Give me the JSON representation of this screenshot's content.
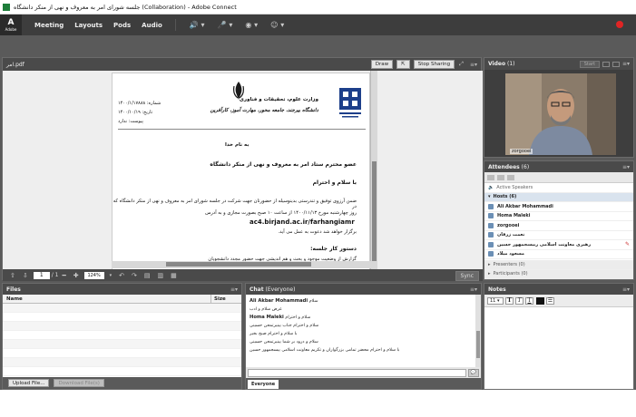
{
  "window": {
    "title": "جلسه شورای امر به معروف و نهی از منکر دانشگاه (Collaboration) - Adobe Connect"
  },
  "menubar": {
    "logo": "Adobe",
    "items": [
      "Meeting",
      "Layouts",
      "Pods",
      "Audio"
    ]
  },
  "share": {
    "filename": "امر.pdf",
    "buttons": {
      "draw": "Draw",
      "stop": "Stop Sharing"
    },
    "page_current": "1",
    "page_total": "/ 1",
    "zoom": "124%",
    "sync": "Sync"
  },
  "document": {
    "ministry": "وزارت علوم، تحقیقات و فناوری",
    "university": "دانشگاه بیرجند، جامعه محور، مهارت آموز، کارآفرین",
    "meta_number": "شماره: ۱۴۰۰/۱/۱۷۸۸۸",
    "meta_date": "تاریخ: ۱۴۰۰/۱۰/۱۹",
    "meta_attach": "پیوست: ندارد",
    "bismillah": "به نام خدا",
    "greeting1": "عضو محترم ستاد امر به معروف و نهی از منکر دانشگاه",
    "greeting2": "با سلام و احترام",
    "body1": "ضمن آرزوی توفیق و تندرستی بدینوسیله از حضورتان جهت شرکت در جلسه شورای امر به معروف و نهی از منکر دانشگاه که در",
    "body2": "روز چهارشنبه مورخ ۱۴۰۰/۱۱/۱۳ از ساعت ۱۰ صبح بصورت مجازی و به آدرس",
    "body_web": "ac4.birjand.ac.ir/farhangiamr",
    "body3": "برگزار خواهد شد دعوت به عمل می آید.",
    "agenda": "دستور کار جلسه:",
    "agenda1": "گزارش از وضعیت موجود و بحث و هم اندیشی جهت حضور مجدد دانشجویان"
  },
  "video": {
    "title": "Video",
    "count": "(1)",
    "start_label": "Start",
    "participant": "zorgooei"
  },
  "attendees": {
    "title": "Attendees",
    "count": "(6)",
    "active_speakers": "Active Speakers",
    "hosts_label": "Hosts (6)",
    "hosts": [
      "Ali Akbar Mohammadi",
      "Homa Maleki",
      "zorgooei",
      "نعمت زرقان",
      "رهبری معاونت اسلامی رییسجمهور حسین",
      "مسعود میلاد"
    ],
    "presenters": "Presenters (0)",
    "participants": "Participants (0)"
  },
  "files": {
    "title": "Files",
    "col_name": "Name",
    "col_size": "Size",
    "upload": "Upload File...",
    "download": "Download File(s)"
  },
  "chat": {
    "title": "Chat",
    "scope": "(Everyone)",
    "messages": [
      {
        "sender": "Ali Akbar Mohammadi",
        "text": "سلام"
      },
      {
        "sender": "",
        "text": "عرض سلام و ادب"
      },
      {
        "sender": "Homa Maleki",
        "text": "سلام و احترام"
      },
      {
        "sender": "",
        "text": "سلام و احترام جناب یینیرتمحن حسینی"
      },
      {
        "sender": "",
        "text": "با سلام و احترام صبح بخیر"
      },
      {
        "sender": "",
        "text": "سلام و درود بر شما یینیرتمحن حسینی"
      },
      {
        "sender": "",
        "text": "با سلام و احترام محضر تمامی بزرگواران و تکریم معاونت اسلامی ییسجمهور حسین"
      }
    ],
    "tab": "Everyone"
  },
  "notes": {
    "title": "Notes",
    "font_size": "11"
  }
}
